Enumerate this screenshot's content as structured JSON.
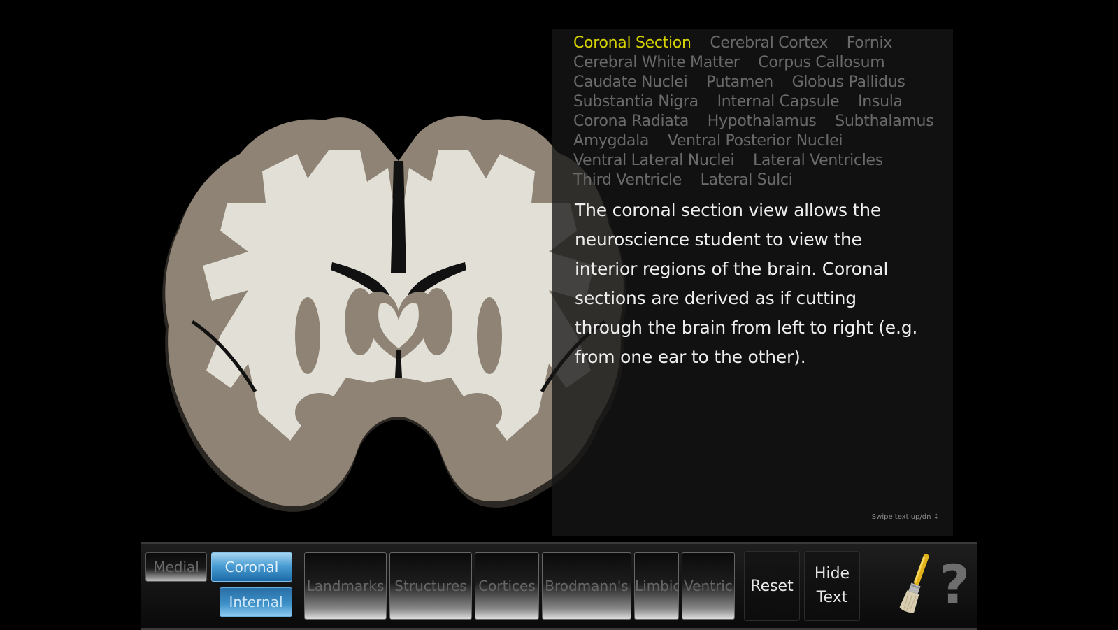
{
  "info": {
    "terms": [
      {
        "label": "Coronal Section",
        "active": true
      },
      {
        "label": "Cerebral Cortex"
      },
      {
        "label": "Fornix"
      },
      {
        "label": "Cerebral White Matter"
      },
      {
        "label": "Corpus Callosum"
      },
      {
        "label": "Caudate Nuclei"
      },
      {
        "label": "Putamen"
      },
      {
        "label": "Globus Pallidus"
      },
      {
        "label": "Substantia Nigra"
      },
      {
        "label": "Internal Capsule"
      },
      {
        "label": "Insula"
      },
      {
        "label": "Corona Radiata"
      },
      {
        "label": "Hypothalamus"
      },
      {
        "label": "Subthalamus"
      },
      {
        "label": "Amygdala"
      },
      {
        "label": "Ventral Posterior Nuclei"
      },
      {
        "label": "Ventral Lateral Nuclei"
      },
      {
        "label": "Lateral Ventricles"
      },
      {
        "label": "Third Ventricle"
      },
      {
        "label": "Lateral Sulci"
      }
    ],
    "description": "The coronal section view allows the neuroscience student to view the interior regions of the brain. Coronal sections are derived as if cutting through the brain from left to right (e.g. from one ear to the other).",
    "swipe_hint": "Swipe text up/dn ↕"
  },
  "toolbar": {
    "medial": "Medial",
    "coronal": "Coronal",
    "internal": "Internal",
    "categories": [
      "Landmarks",
      "Structures",
      "Cortices",
      "Brodmann's",
      "Limbic",
      "Ventric"
    ],
    "reset": "Reset",
    "hide_text_line1": "Hide",
    "hide_text_line2": "Text",
    "help": "?"
  },
  "colors": {
    "active_term": "#d6d200",
    "inactive_term": "#6a6a6a",
    "active_view": "#4a9ed4",
    "white_matter": "#e2e0d6",
    "gray_matter": "#8e8374"
  },
  "icons": {
    "paintbrush": "paintbrush-icon",
    "help": "question-mark-icon"
  }
}
